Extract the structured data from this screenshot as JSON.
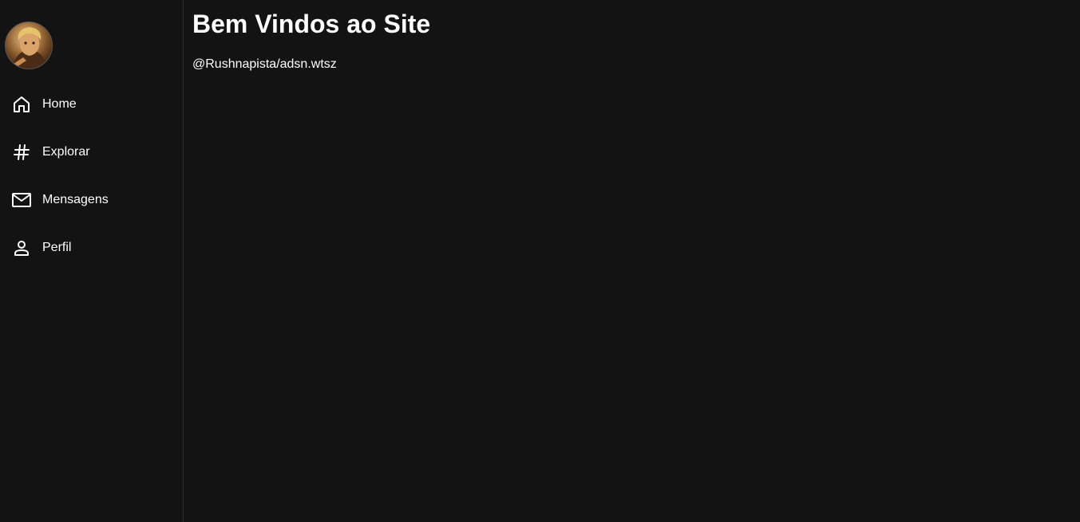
{
  "sidebar": {
    "items": [
      {
        "label": "Home",
        "icon": "home-icon"
      },
      {
        "label": "Explorar",
        "icon": "hashtag-icon"
      },
      {
        "label": "Mensagens",
        "icon": "mail-icon"
      },
      {
        "label": "Perfil",
        "icon": "user-icon"
      }
    ]
  },
  "main": {
    "title": "Bem Vindos ao Site",
    "handle": "@Rushnapista/adsn.wtsz"
  },
  "colors": {
    "background": "#131313",
    "text": "#ffffff",
    "divider": "#2f2f2f"
  }
}
